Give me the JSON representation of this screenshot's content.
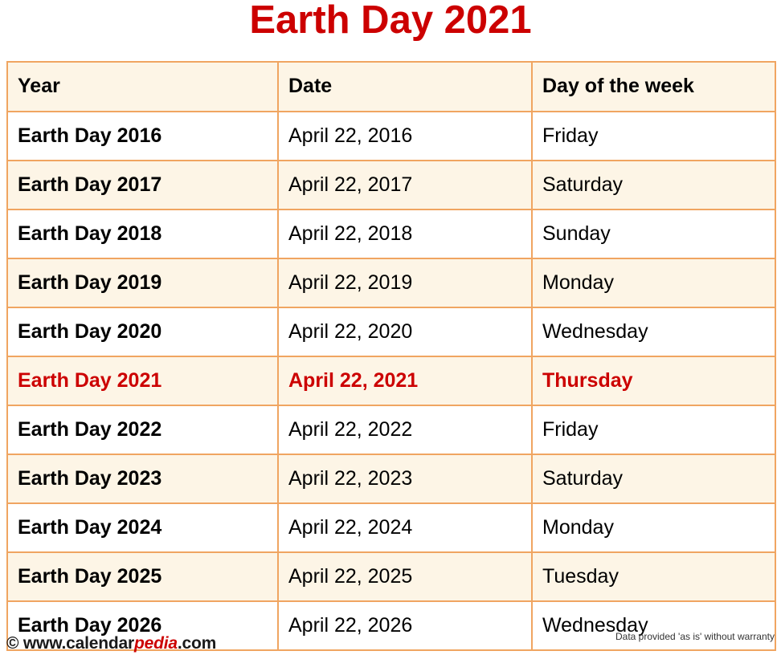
{
  "title": "Earth Day 2021",
  "table": {
    "headers": [
      "Year",
      "Date",
      "Day of the week"
    ],
    "rows": [
      {
        "year": "Earth Day 2016",
        "date": "April 22, 2016",
        "dow": "Friday"
      },
      {
        "year": "Earth Day 2017",
        "date": "April 22, 2017",
        "dow": "Saturday"
      },
      {
        "year": "Earth Day 2018",
        "date": "April 22, 2018",
        "dow": "Sunday"
      },
      {
        "year": "Earth Day 2019",
        "date": "April 22, 2019",
        "dow": "Monday"
      },
      {
        "year": "Earth Day 2020",
        "date": "April 22, 2020",
        "dow": "Wednesday"
      },
      {
        "year": "Earth Day 2021",
        "date": "April 22, 2021",
        "dow": "Thursday",
        "highlight": true
      },
      {
        "year": "Earth Day 2022",
        "date": "April 22, 2022",
        "dow": "Friday"
      },
      {
        "year": "Earth Day 2023",
        "date": "April 22, 2023",
        "dow": "Saturday"
      },
      {
        "year": "Earth Day 2024",
        "date": "April 22, 2024",
        "dow": "Monday"
      },
      {
        "year": "Earth Day 2025",
        "date": "April 22, 2025",
        "dow": "Tuesday"
      },
      {
        "year": "Earth Day 2026",
        "date": "April 22, 2026",
        "dow": "Wednesday"
      }
    ]
  },
  "footer": {
    "copyright_symbol": "©",
    "site_prefix": "www.calendar",
    "site_accent": "pedia",
    "site_suffix": ".com",
    "disclaimer": "Data provided 'as is' without warranty"
  },
  "colors": {
    "accent_red": "#CC0000",
    "table_border": "#F0A561",
    "row_cream": "#FDF5E6",
    "row_white": "#FFFFFF",
    "text": "#000000"
  }
}
